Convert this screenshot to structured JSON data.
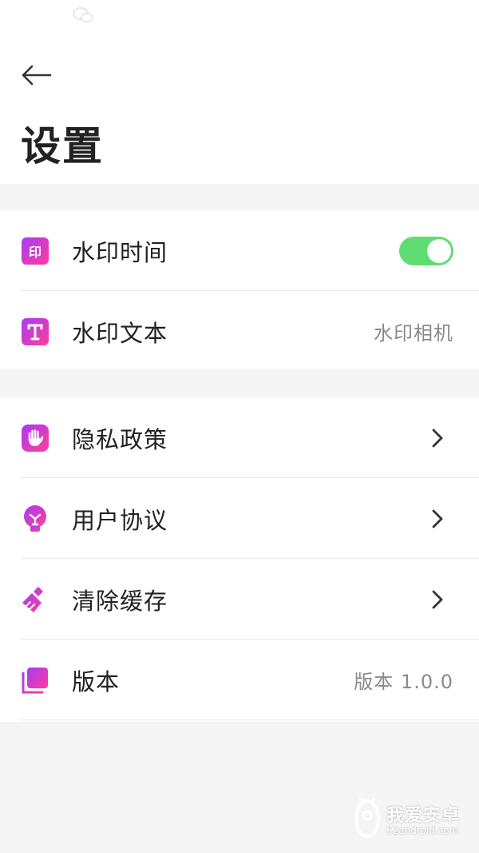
{
  "header": {
    "title": "设置"
  },
  "settings": {
    "group1": [
      {
        "label": "水印时间",
        "icon": "stamp-icon",
        "toggle_on": true
      },
      {
        "label": "水印文本",
        "icon": "text-t-icon",
        "value": "水印相机"
      }
    ],
    "group2": [
      {
        "label": "隐私政策",
        "icon": "hand-icon"
      },
      {
        "label": "用户协议",
        "icon": "bulb-icon"
      },
      {
        "label": "清除缓存",
        "icon": "broom-icon"
      },
      {
        "label": "版本",
        "icon": "layers-icon",
        "value": "版本 1.0.0"
      }
    ]
  },
  "watermark": {
    "brand": "我爱安卓",
    "site": "52android.com"
  },
  "colors": {
    "icon_gradient_start": "#c23cf0",
    "icon_gradient_end": "#ff3d9a",
    "toggle_on": "#5fdd72",
    "page_bg": "#f5f5f5"
  }
}
